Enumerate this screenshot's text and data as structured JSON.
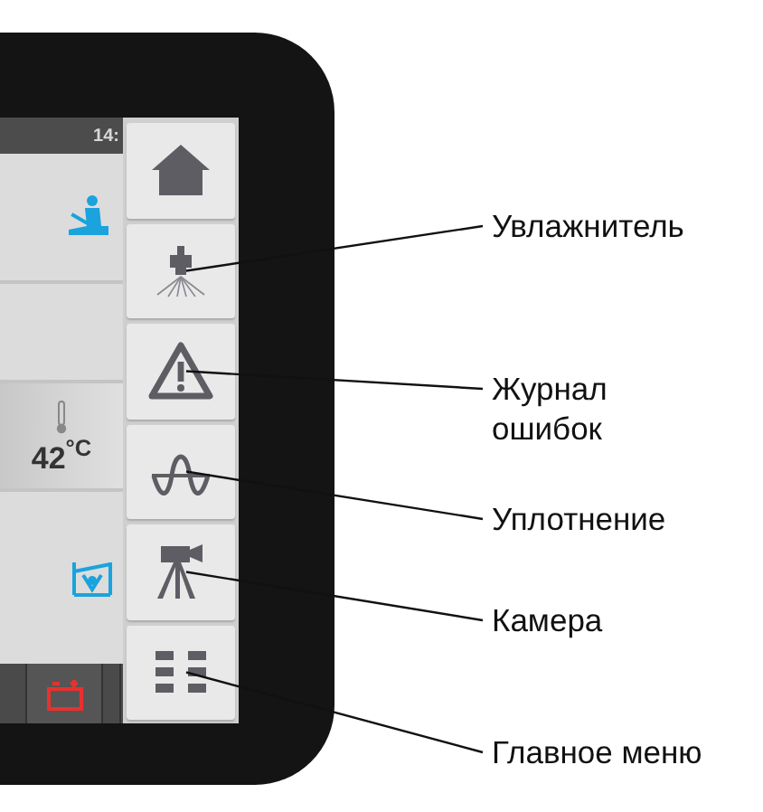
{
  "status_bar": {
    "time": "14:"
  },
  "tiles": [
    {
      "kind": "worker"
    },
    {
      "kind": "blank"
    },
    {
      "kind": "temperature",
      "reading": "42$^{°C}$"
    },
    {
      "kind": "leveling"
    }
  ],
  "bottom_bar": [
    {
      "kind": "blank"
    },
    {
      "kind": "battery"
    },
    {
      "kind": "blank"
    }
  ],
  "side_buttons": [
    {
      "kind": "home"
    },
    {
      "kind": "humidifier",
      "callout": "Увлажнитель"
    },
    {
      "kind": "warning",
      "callout": "Журнал ошибок"
    },
    {
      "kind": "wave",
      "callout": "Уплотнение"
    },
    {
      "kind": "camera",
      "callout": "Камера"
    },
    {
      "kind": "menu",
      "callout": "Главное меню"
    }
  ]
}
